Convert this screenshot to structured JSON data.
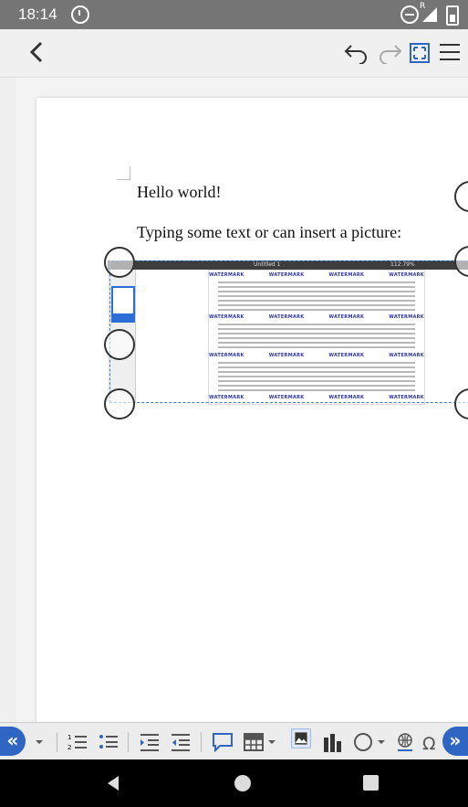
{
  "status_bar": {
    "time": "18:14",
    "carrier_label": "R"
  },
  "toolbar": {
    "back_icon": "arrow-left-icon",
    "undo_icon": "undo-icon",
    "redo_icon": "redo-icon",
    "fullscreen_icon": "fullscreen-icon",
    "menu_icon": "hamburger-menu-icon"
  },
  "document": {
    "line1": "Hello world!",
    "line2": "Typing some text or can insert a picture:"
  },
  "inserted_image": {
    "watermark": "WATERMARK",
    "title": "Untitled 1",
    "zoom": "112.79%"
  },
  "formatting_bar": {
    "scroll_left": "«",
    "scroll_right": "»",
    "icons": [
      "bullets-dropdown-icon",
      "numbered-list-icon",
      "bulleted-list-icon",
      "increase-indent-icon",
      "decrease-indent-icon",
      "comment-icon",
      "table-icon",
      "image-icon",
      "chart-icon",
      "shape-icon",
      "hyperlink-icon",
      "special-character-icon"
    ]
  },
  "nav_bar": {
    "back_icon": "nav-back-icon",
    "home_icon": "nav-home-icon",
    "recents_icon": "nav-recents-icon"
  }
}
